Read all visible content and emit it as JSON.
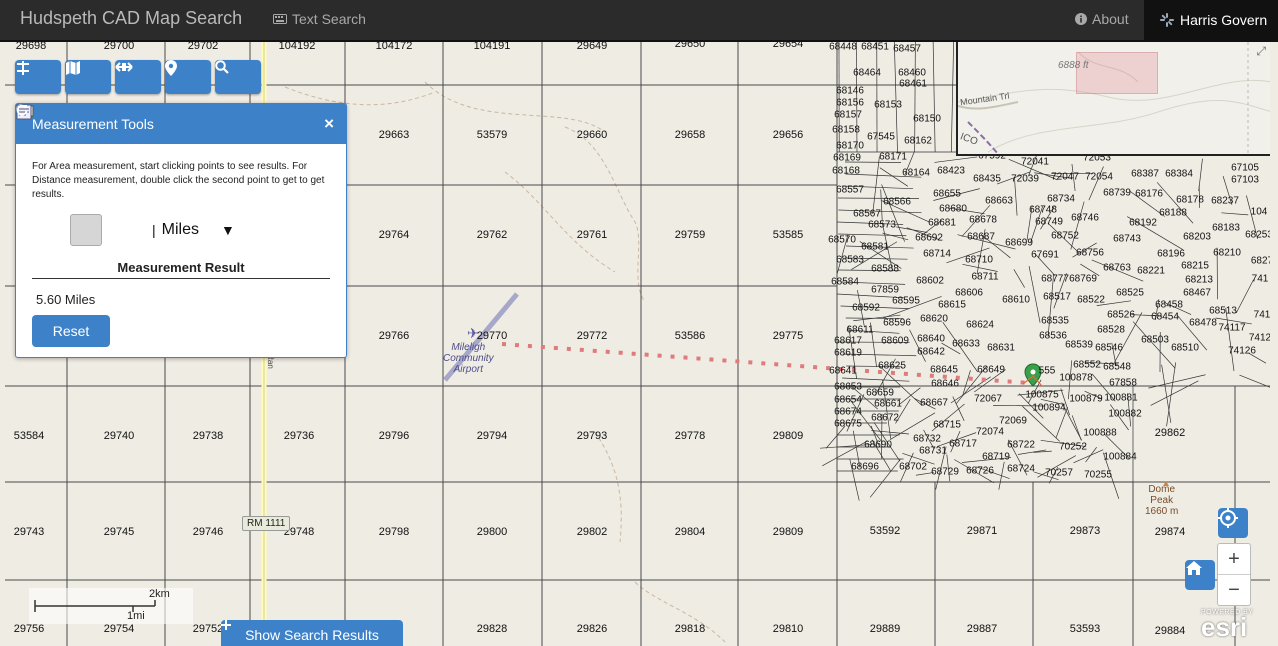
{
  "navbar": {
    "brand": "Hudspeth CAD Map Search",
    "text_search": "Text Search",
    "about": "About",
    "user": "Harris Govern"
  },
  "toolbar": {
    "icons": [
      "layers-icon",
      "basemap-icon",
      "measure-icon",
      "location-pin-icon",
      "search-icon"
    ]
  },
  "measurement_panel": {
    "title": "Measurement Tools",
    "close": "×",
    "instructions": "For Area measurement, start clicking points to see results. For Distance measurement, double click the second point to get to get results.",
    "units": "Miles",
    "units_caret": "▼",
    "separator": "|",
    "result_title": "Measurement Result",
    "result_value": "5.60 Miles",
    "reset_label": "Reset"
  },
  "map": {
    "overview_elevation": "6888 ft",
    "overview_trail": "Mountain Trl",
    "overview_partial": "ICO",
    "road_shield": "RM 1111",
    "road_side_label": "Ran",
    "airport": [
      "Mileligh",
      "Community",
      "Airport"
    ],
    "peak": [
      "Dome",
      "Peak",
      "1660 m"
    ],
    "scale_km": "2km",
    "scale_mi": "1mi",
    "show_results": "Show Search Results",
    "esri_powered": "POWERED BY",
    "esri_logo": "esri",
    "zoom_in": "+",
    "zoom_out": "−",
    "grid_labels": [
      [
        "29698",
        26,
        4
      ],
      [
        "29700",
        114,
        4
      ],
      [
        "29702",
        198,
        4
      ],
      [
        "104192",
        292,
        4
      ],
      [
        "104172",
        389,
        4
      ],
      [
        "104191",
        487,
        4
      ],
      [
        "29649",
        587,
        4
      ],
      [
        "29650",
        685,
        2
      ],
      [
        "29654",
        783,
        2
      ],
      [
        "29663",
        389,
        93
      ],
      [
        "53579",
        487,
        93
      ],
      [
        "29660",
        587,
        93
      ],
      [
        "29658",
        685,
        93
      ],
      [
        "29656",
        783,
        93
      ],
      [
        "29764",
        389,
        193
      ],
      [
        "29762",
        487,
        193
      ],
      [
        "29761",
        587,
        193
      ],
      [
        "29759",
        685,
        193
      ],
      [
        "53585",
        783,
        193
      ],
      [
        "29766",
        389,
        294
      ],
      [
        "29770",
        487,
        294
      ],
      [
        "29772",
        587,
        294
      ],
      [
        "53586",
        685,
        294
      ],
      [
        "29775",
        783,
        294
      ],
      [
        "53584",
        24,
        394
      ],
      [
        "29740",
        114,
        394
      ],
      [
        "29738",
        203,
        394
      ],
      [
        "29736",
        294,
        394
      ],
      [
        "29796",
        389,
        394
      ],
      [
        "29794",
        487,
        394
      ],
      [
        "29793",
        587,
        394
      ],
      [
        "29778",
        685,
        394
      ],
      [
        "29809",
        783,
        394
      ],
      [
        "29862",
        1165,
        391
      ],
      [
        "29743",
        24,
        490
      ],
      [
        "29745",
        114,
        490
      ],
      [
        "29746",
        203,
        490
      ],
      [
        "29748",
        294,
        490
      ],
      [
        "29798",
        389,
        490
      ],
      [
        "29800",
        487,
        490
      ],
      [
        "29802",
        587,
        490
      ],
      [
        "29804",
        685,
        490
      ],
      [
        "29809",
        783,
        490
      ],
      [
        "53592",
        880,
        489
      ],
      [
        "29871",
        977,
        489
      ],
      [
        "29873",
        1080,
        489
      ],
      [
        "29874",
        1165,
        490
      ],
      [
        "29756",
        24,
        587
      ],
      [
        "29754",
        114,
        587
      ],
      [
        "29752",
        203,
        587
      ],
      [
        "29828",
        487,
        587
      ],
      [
        "29826",
        587,
        587
      ],
      [
        "29818",
        685,
        587
      ],
      [
        "29810",
        783,
        587
      ],
      [
        "29889",
        880,
        587
      ],
      [
        "29887",
        977,
        587
      ],
      [
        "53593",
        1080,
        587
      ],
      [
        "29884",
        1165,
        589
      ]
    ],
    "small_labels": [
      [
        "68448",
        838,
        5
      ],
      [
        "68451",
        870,
        5
      ],
      [
        "68457",
        902,
        7
      ],
      [
        "68464",
        862,
        31
      ],
      [
        "68460",
        907,
        31
      ],
      [
        "68461",
        908,
        42
      ],
      [
        "68146",
        845,
        49
      ],
      [
        "68156",
        845,
        61
      ],
      [
        "68153",
        883,
        63
      ],
      [
        "68157",
        843,
        73
      ],
      [
        "68150",
        922,
        77
      ],
      [
        "68158",
        841,
        88
      ],
      [
        "67545",
        876,
        95
      ],
      [
        "68162",
        913,
        99
      ],
      [
        "68170",
        845,
        104
      ],
      [
        "68169",
        842,
        116
      ],
      [
        "68171",
        888,
        115
      ],
      [
        "68168",
        841,
        129
      ],
      [
        "68164",
        911,
        131
      ],
      [
        "68423",
        946,
        129
      ],
      [
        "67592",
        987,
        114
      ],
      [
        "72041",
        1030,
        120
      ],
      [
        "72053",
        1092,
        116
      ],
      [
        "72039",
        1020,
        137
      ],
      [
        "72047",
        1060,
        135
      ],
      [
        "72054",
        1094,
        135
      ],
      [
        "68435",
        982,
        137
      ],
      [
        "68387",
        1140,
        132
      ],
      [
        "68384",
        1174,
        132
      ],
      [
        "67105",
        1240,
        126
      ],
      [
        "67103",
        1240,
        138
      ],
      [
        "68557",
        845,
        148
      ],
      [
        "68655",
        942,
        152
      ],
      [
        "68739",
        1112,
        151
      ],
      [
        "68176",
        1144,
        152
      ],
      [
        "68178",
        1185,
        158
      ],
      [
        "68237",
        1220,
        159
      ],
      [
        "104",
        1254,
        170
      ],
      [
        "68566",
        892,
        160
      ],
      [
        "68663",
        994,
        159
      ],
      [
        "68734",
        1056,
        157
      ],
      [
        "68680",
        948,
        167
      ],
      [
        "68748",
        1038,
        168
      ],
      [
        "68567",
        862,
        172
      ],
      [
        "68678",
        978,
        178
      ],
      [
        "68746",
        1080,
        176
      ],
      [
        "68188",
        1168,
        171
      ],
      [
        "68192",
        1138,
        181
      ],
      [
        "68573",
        877,
        183
      ],
      [
        "68681",
        937,
        181
      ],
      [
        "68749",
        1044,
        180
      ],
      [
        "68183",
        1221,
        186
      ],
      [
        "68253",
        1254,
        193
      ],
      [
        "68570",
        837,
        198
      ],
      [
        "68692",
        924,
        196
      ],
      [
        "68687",
        976,
        195
      ],
      [
        "68752",
        1060,
        194
      ],
      [
        "68743",
        1122,
        197
      ],
      [
        "68203",
        1192,
        195
      ],
      [
        "68581",
        870,
        205
      ],
      [
        "68699",
        1014,
        201
      ],
      [
        "68583",
        845,
        218
      ],
      [
        "68714",
        932,
        212
      ],
      [
        "68710",
        974,
        218
      ],
      [
        "67691",
        1040,
        213
      ],
      [
        "68756",
        1085,
        211
      ],
      [
        "68196",
        1166,
        212
      ],
      [
        "68210",
        1222,
        211
      ],
      [
        "6827",
        1257,
        219
      ],
      [
        "68588",
        880,
        227
      ],
      [
        "68711",
        980,
        235
      ],
      [
        "68763",
        1112,
        226
      ],
      [
        "68221",
        1146,
        229
      ],
      [
        "68215",
        1190,
        224
      ],
      [
        "68584",
        840,
        240
      ],
      [
        "68602",
        925,
        239
      ],
      [
        "68777",
        1050,
        237
      ],
      [
        "68769",
        1078,
        237
      ],
      [
        "68213",
        1194,
        238
      ],
      [
        "741",
        1255,
        237
      ],
      [
        "67859",
        880,
        248
      ],
      [
        "68606",
        964,
        251
      ],
      [
        "68525",
        1125,
        251
      ],
      [
        "68467",
        1192,
        251
      ],
      [
        "68592",
        861,
        266
      ],
      [
        "68595",
        901,
        259
      ],
      [
        "68615",
        947,
        263
      ],
      [
        "68610",
        1011,
        258
      ],
      [
        "68517",
        1052,
        255
      ],
      [
        "68522",
        1086,
        258
      ],
      [
        "68458",
        1164,
        263
      ],
      [
        "68513",
        1218,
        269
      ],
      [
        "741",
        1257,
        273
      ],
      [
        "68620",
        929,
        277
      ],
      [
        "68596",
        892,
        281
      ],
      [
        "68624",
        975,
        283
      ],
      [
        "68535",
        1050,
        279
      ],
      [
        "68526",
        1116,
        273
      ],
      [
        "68454",
        1160,
        275
      ],
      [
        "68478",
        1198,
        281
      ],
      [
        "74117",
        1227,
        286
      ],
      [
        "68611",
        855,
        288
      ],
      [
        "68536",
        1048,
        294
      ],
      [
        "68528",
        1106,
        288
      ],
      [
        "68503",
        1150,
        298
      ],
      [
        "7412",
        1255,
        296
      ],
      [
        "68617",
        843,
        299
      ],
      [
        "68609",
        890,
        299
      ],
      [
        "68640",
        926,
        297
      ],
      [
        "68633",
        961,
        302
      ],
      [
        "68539",
        1074,
        303
      ],
      [
        "68546",
        1104,
        306
      ],
      [
        "68510",
        1180,
        306
      ],
      [
        "74126",
        1237,
        309
      ],
      [
        "68619",
        843,
        311
      ],
      [
        "68642",
        926,
        310
      ],
      [
        "68631",
        996,
        306
      ],
      [
        "68641",
        838,
        329
      ],
      [
        "68625",
        887,
        324
      ],
      [
        "68645",
        939,
        328
      ],
      [
        "68649",
        986,
        328
      ],
      [
        "555",
        1042,
        329
      ],
      [
        "68552",
        1082,
        323
      ],
      [
        "68548",
        1112,
        325
      ],
      [
        "100878",
        1071,
        336
      ],
      [
        "68646",
        940,
        342
      ],
      [
        "67858",
        1118,
        341
      ],
      [
        "68653",
        843,
        345
      ],
      [
        "68659",
        875,
        351
      ],
      [
        "100875",
        1037,
        353
      ],
      [
        "100879",
        1081,
        357
      ],
      [
        "100881",
        1116,
        356
      ],
      [
        "68654",
        843,
        358
      ],
      [
        "68661",
        883,
        362
      ],
      [
        "68667",
        929,
        361
      ],
      [
        "72067",
        983,
        357
      ],
      [
        "100894",
        1044,
        366
      ],
      [
        "100882",
        1120,
        372
      ],
      [
        "68674",
        843,
        370
      ],
      [
        "68672",
        880,
        376
      ],
      [
        "72069",
        1008,
        379
      ],
      [
        "68675",
        843,
        382
      ],
      [
        "68715",
        942,
        383
      ],
      [
        "72074",
        985,
        390
      ],
      [
        "100888",
        1095,
        391
      ],
      [
        "68732",
        922,
        397
      ],
      [
        "68690",
        873,
        403
      ],
      [
        "68731",
        928,
        409
      ],
      [
        "68717",
        958,
        402
      ],
      [
        "68722",
        1016,
        403
      ],
      [
        "70252",
        1068,
        405
      ],
      [
        "100884",
        1115,
        415
      ],
      [
        "68719",
        991,
        415
      ],
      [
        "68696",
        860,
        425
      ],
      [
        "68702",
        908,
        425
      ],
      [
        "68729",
        940,
        430
      ],
      [
        "68726",
        975,
        429
      ],
      [
        "68724",
        1016,
        427
      ],
      [
        "70257",
        1054,
        431
      ],
      [
        "70255",
        1093,
        433
      ]
    ]
  }
}
